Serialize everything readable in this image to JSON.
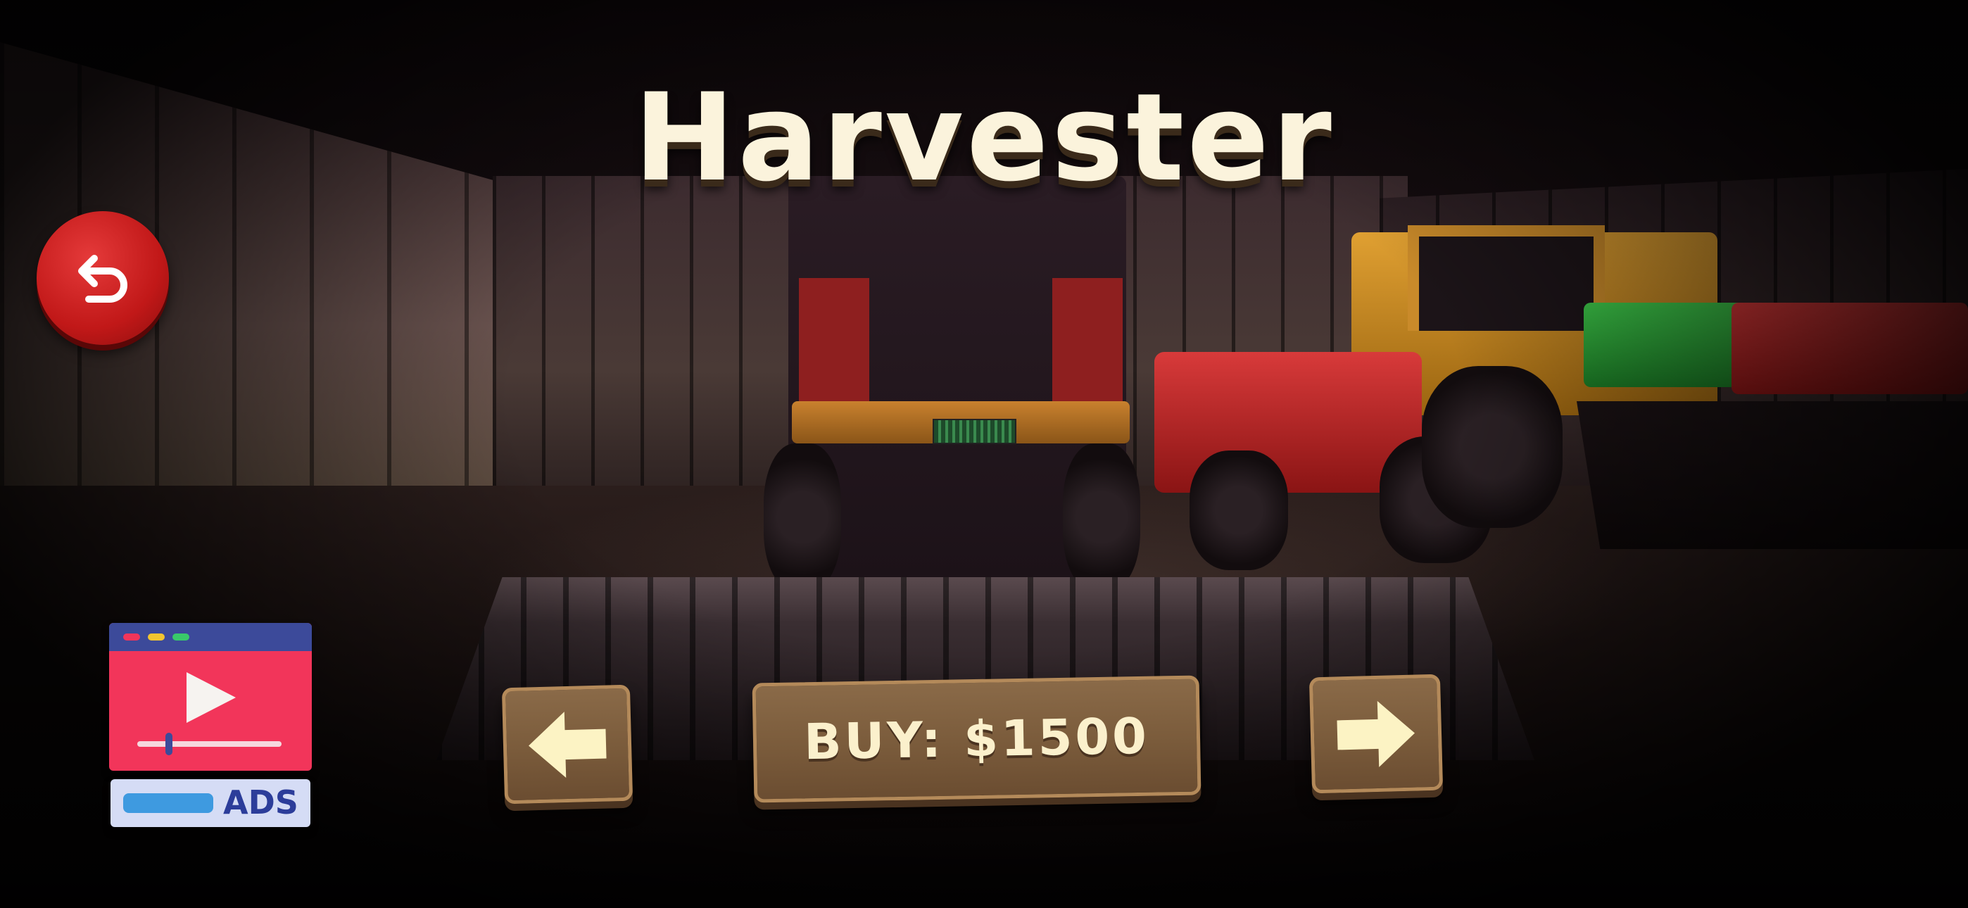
{
  "title": "Harvester",
  "buy_button": {
    "label": "BUY: $1500"
  },
  "ads_button": {
    "label": "ADS"
  },
  "icons": {
    "back": "undo-arrow-icon",
    "prev": "left-arrow-icon",
    "next": "right-arrow-icon",
    "ads": "video-play-icon"
  },
  "colors": {
    "title": "#fbf3dc",
    "back_button": "#c11818",
    "wood": "#7a5b3b",
    "wood_text": "#fbf0cc",
    "arrow": "#fcf3c4",
    "ads_red": "#f2355a",
    "ads_blue": "#3c4a9a"
  }
}
